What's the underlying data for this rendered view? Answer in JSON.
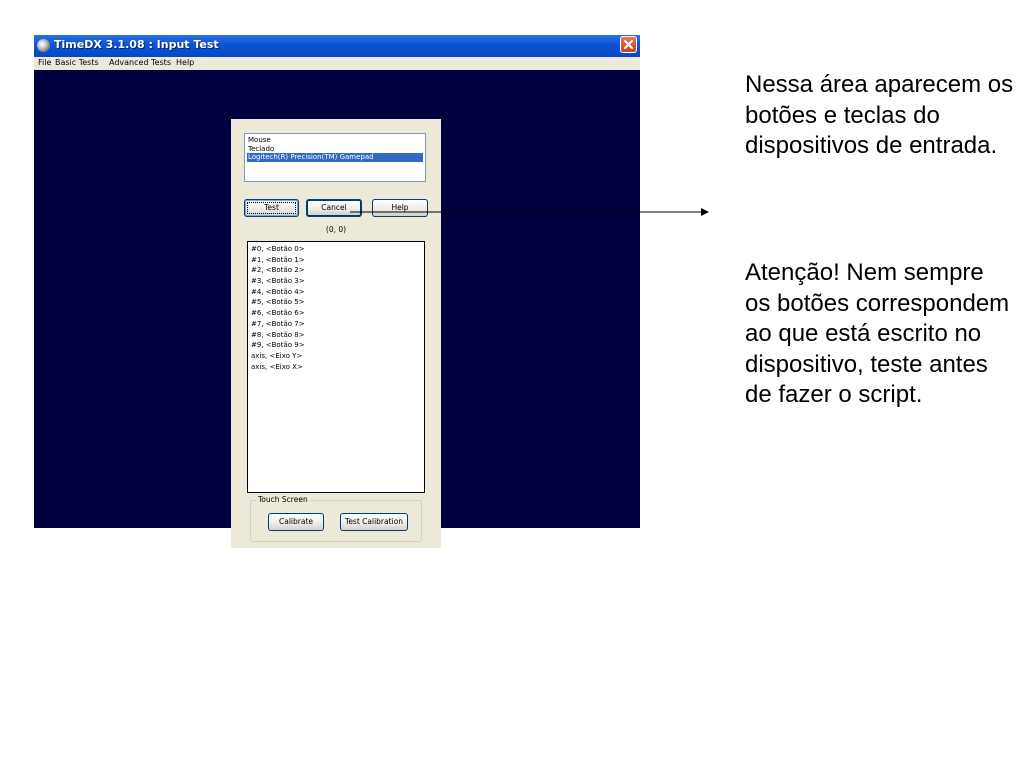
{
  "window": {
    "title": "TimeDX 3.1.08 : Input Test",
    "menu": [
      "File",
      "Basic Tests",
      "Advanced Tests",
      "Help"
    ]
  },
  "dialog": {
    "devices": [
      "Mouse",
      "Teclado",
      "Logitech(R) Precision(TM) Gamepad"
    ],
    "selected_device_index": 2,
    "buttons": {
      "test": "Test",
      "cancel": "Cancel",
      "help": "Help"
    },
    "coordinates": "(0, 0)",
    "events": [
      "#0, <Botão 0>",
      "#1, <Botão 1>",
      "#2, <Botão 2>",
      "#3, <Botão 3>",
      "#4, <Botão 4>",
      "#5, <Botão 5>",
      "#6, <Botão 6>",
      "#7, <Botão 7>",
      "#8, <Botão 8>",
      "#9, <Botão 9>",
      "axis, <Eixo Y>",
      "axis, <Eixo X>"
    ],
    "touch_screen": {
      "label": "Touch Screen",
      "calibrate": "Calibrate",
      "test_calibration": "Test Calibration"
    }
  },
  "annotation": {
    "note1": "Nessa área aparecem os botões e teclas do dispositivos de entrada.",
    "note2": "Atenção! Nem sempre os botões correspondem ao que está escrito no dispositivo, teste antes de fazer o script."
  },
  "colors": {
    "desktop_bg": "#000040",
    "titlebar": "#0a54d6",
    "selection": "#316ac5",
    "dialog_bg": "#ece9d8"
  }
}
